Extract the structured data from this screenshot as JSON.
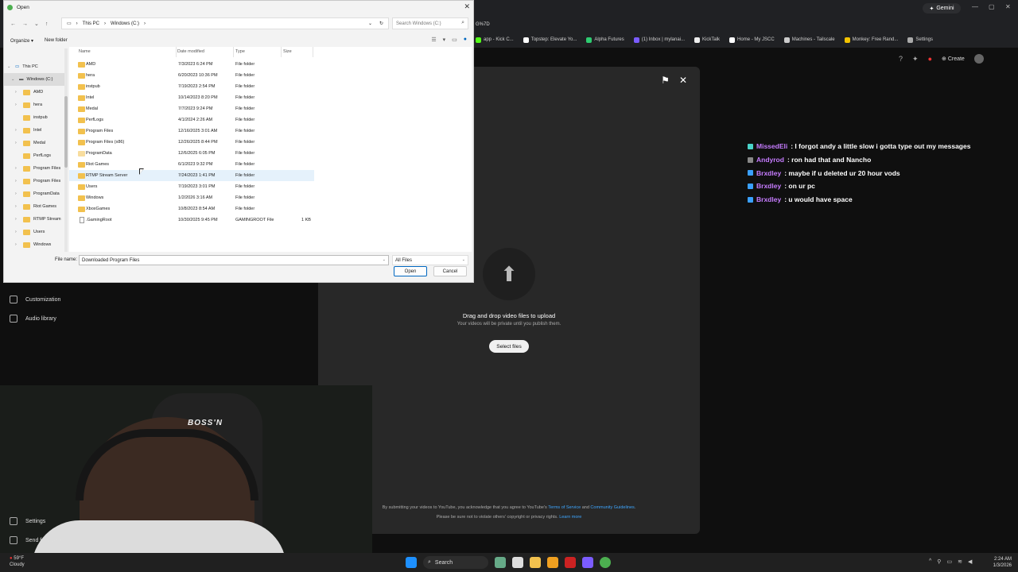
{
  "browser": {
    "url_fragment": "G%7D",
    "gemini_label": "Gemini",
    "bookmarks": [
      "app - Kick C...",
      "Topstep: Elevate Yo...",
      "Alpha Futures",
      "(1) Inbox | mylanai...",
      "KickTalk",
      "Home - My JSCC",
      "Machines - Tailscale",
      "Monkey: Free Rand...",
      "Settings"
    ]
  },
  "studio": {
    "create_label": "Create",
    "sidebar": [
      "Customization",
      "Audio library",
      "Settings",
      "Send feedback"
    ]
  },
  "upload": {
    "title": "Drag and drop video files to upload",
    "subtitle": "Your videos will be private until you publish them.",
    "select_label": "Select files",
    "terms_pre": "By submitting your videos to YouTube, you acknowledge that you agree to YouTube's",
    "terms_link": "Terms of Service",
    "terms_and": "and",
    "guidelines_link": "Community Guidelines",
    "terms_end": ".",
    "copyright": "Please be sure not to violate others' copyright or privacy rights.",
    "learn_more": "Learn more"
  },
  "chat": [
    {
      "user": "MissedEli",
      "msg": ": I forgot andy a little slow i gotta type out my messages",
      "badge": "#4ad3c9"
    },
    {
      "user": "Andyrod",
      "msg": ": ron had that and Nancho",
      "badge": "#888888"
    },
    {
      "user": "Brxdley",
      "msg": ": maybe if u deleted ur 20 hour vods",
      "badge": "#3aa0ff"
    },
    {
      "user": "Brxdley",
      "msg": ": on ur pc",
      "badge": "#3aa0ff"
    },
    {
      "user": "Brxdley",
      "msg": ": u would have space",
      "badge": "#3aa0ff"
    }
  ],
  "webcam": {
    "chair_text": "BOSS'N"
  },
  "taskbar": {
    "search": "Search",
    "weather_temp": "59°F",
    "weather_desc": "Cloudy",
    "time": "2:24 AM",
    "date": "1/3/2026"
  },
  "dialog": {
    "title": "Open",
    "breadcrumb": [
      "This PC",
      "Windows (C:)"
    ],
    "search_placeholder": "Search Windows (C:)",
    "organize": "Organize",
    "new_folder": "New folder",
    "nav": [
      "This PC",
      "Windows (C:)",
      "AMD",
      "hera",
      "instpub",
      "Intel",
      "Medal",
      "PerfLogs",
      "Program Files",
      "Program Files",
      "ProgramData",
      "Riot Games",
      "RTMP Stream",
      "Users",
      "Windows"
    ],
    "columns": [
      "Name",
      "Date modified",
      "Type",
      "Size"
    ],
    "files": [
      {
        "name": "AMD",
        "date": "7/3/2023 6:24 PM",
        "type": "File folder",
        "size": ""
      },
      {
        "name": "hera",
        "date": "6/20/2023 10:36 PM",
        "type": "File folder",
        "size": ""
      },
      {
        "name": "instpub",
        "date": "7/19/2023 2:54 PM",
        "type": "File folder",
        "size": ""
      },
      {
        "name": "Intel",
        "date": "10/14/2023 8:20 PM",
        "type": "File folder",
        "size": ""
      },
      {
        "name": "Medal",
        "date": "7/7/2023 9:24 PM",
        "type": "File folder",
        "size": ""
      },
      {
        "name": "PerfLogs",
        "date": "4/1/2024 2:26 AM",
        "type": "File folder",
        "size": ""
      },
      {
        "name": "Program Files",
        "date": "12/16/2025 3:01 AM",
        "type": "File folder",
        "size": ""
      },
      {
        "name": "Program Files (x86)",
        "date": "12/26/2025 8:44 PM",
        "type": "File folder",
        "size": ""
      },
      {
        "name": "ProgramData",
        "date": "12/6/2025 6:05 PM",
        "type": "File folder",
        "size": ""
      },
      {
        "name": "Riot Games",
        "date": "6/1/2023 9:32 PM",
        "type": "File folder",
        "size": ""
      },
      {
        "name": "RTMP Stream Server",
        "date": "7/24/2023 1:41 PM",
        "type": "File folder",
        "size": ""
      },
      {
        "name": "Users",
        "date": "7/19/2023 3:01 PM",
        "type": "File folder",
        "size": ""
      },
      {
        "name": "Windows",
        "date": "1/2/2026 3:16 AM",
        "type": "File folder",
        "size": ""
      },
      {
        "name": "XboxGames",
        "date": "10/8/2023 8:54 AM",
        "type": "File folder",
        "size": ""
      },
      {
        "name": ".GamingRoot",
        "date": "10/30/2025 9:45 PM",
        "type": "GAMINGROOT File",
        "size": "1 KB"
      }
    ],
    "filename_label": "File name:",
    "filename_value": "Downloaded Program Files",
    "filetype_value": "All Files",
    "open_label": "Open",
    "cancel_label": "Cancel"
  }
}
